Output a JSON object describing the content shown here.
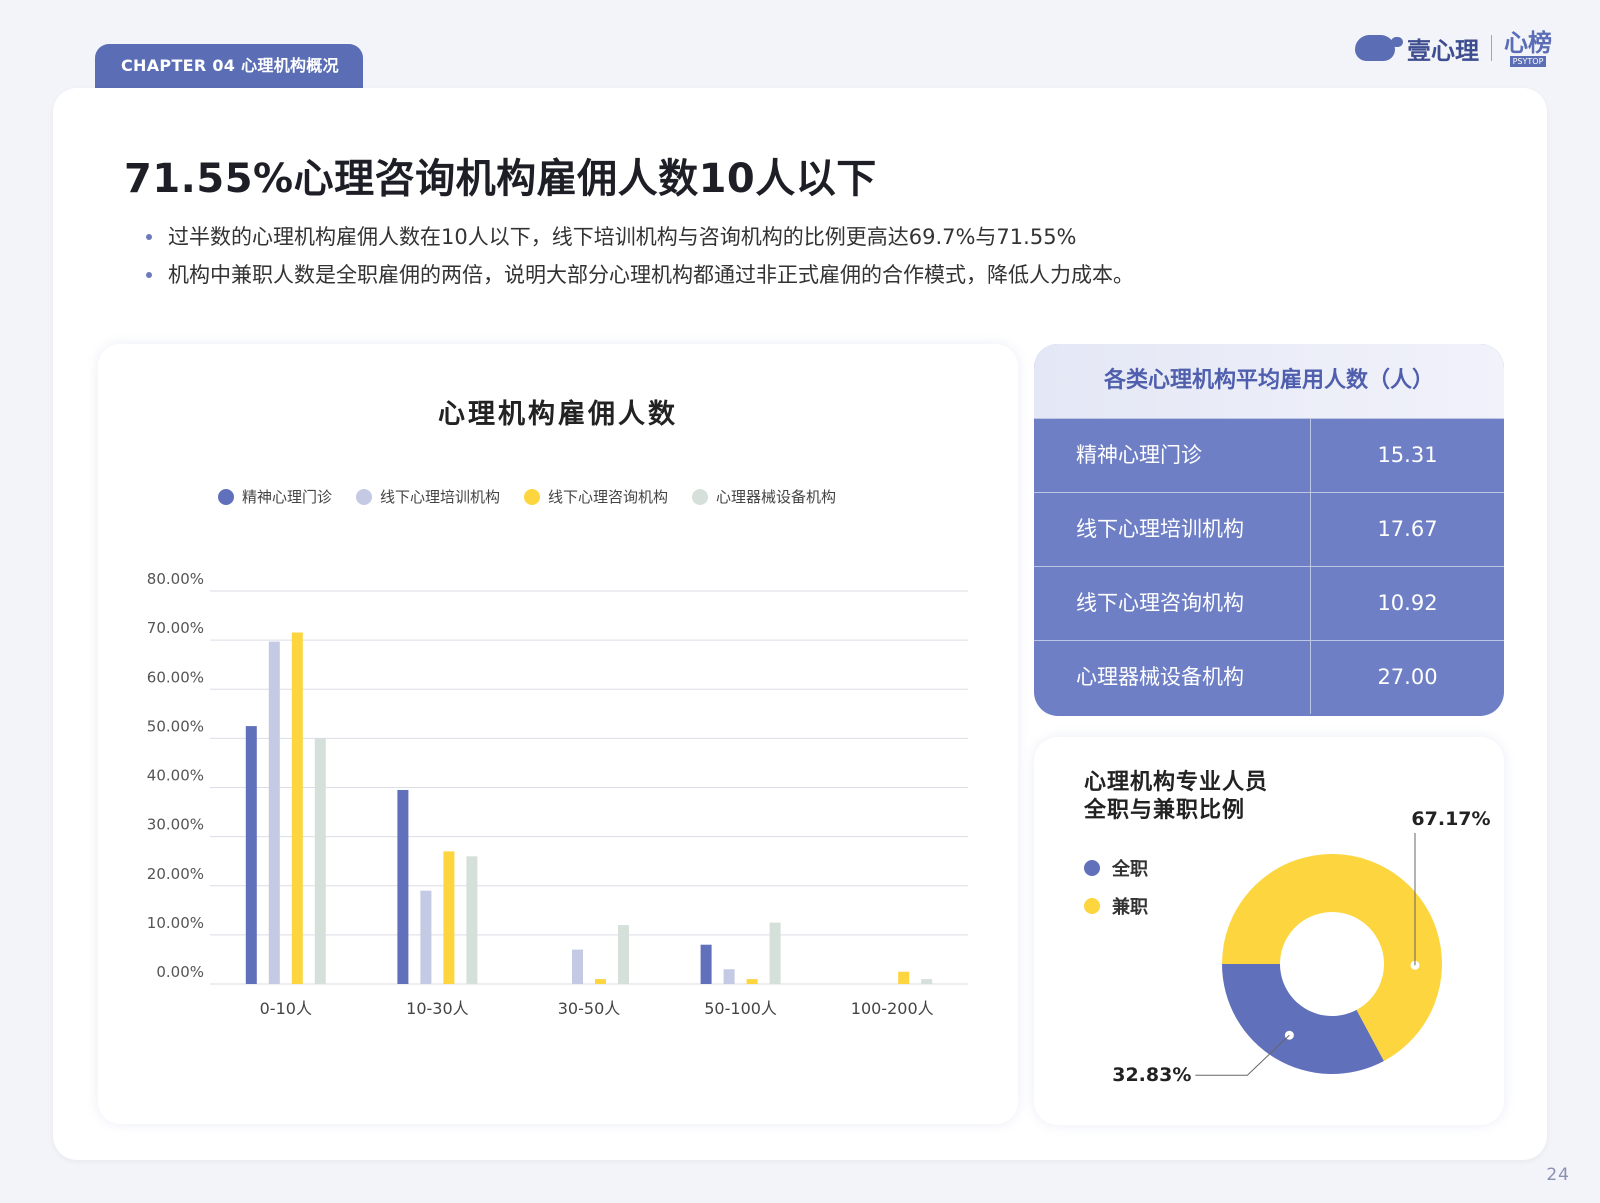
{
  "header": {
    "chapter": "CHAPTER 04  心理机构概况",
    "logo_text": "壹心理",
    "logo_box": "心榜",
    "logo_box_sub": "PSYTOP"
  },
  "headline": "71.55%心理咨询机构雇佣人数10人以下",
  "bullets": [
    "过半数的心理机构雇佣人数在10人以下，线下培训机构与咨询机构的比例更高达69.7%与71.55%",
    "机构中兼职人数是全职雇佣的两倍，说明大部分心理机构都通过非正式雇佣的合作模式，降低人力成本。"
  ],
  "colors": {
    "primary": "#5a6db5",
    "bar_series": [
      "#6070bb",
      "#c4c9e4",
      "#fcd53f",
      "#d6e0db"
    ],
    "pie_fulltime": "#6070bb",
    "pie_parttime": "#fcd53f"
  },
  "table": {
    "title": "各类心理机构平均雇用人数（人）",
    "rows": [
      {
        "label": "精神心理门诊",
        "value": "15.31"
      },
      {
        "label": "线下心理培训机构",
        "value": "17.67"
      },
      {
        "label": "线下心理咨询机构",
        "value": "10.92"
      },
      {
        "label": "心理器械设备机构",
        "value": "27.00"
      }
    ]
  },
  "pie": {
    "title_line1": "心理机构专业人员",
    "title_line2": "全职与兼职比例",
    "legend": [
      "全职",
      "兼职"
    ]
  },
  "page_number": "24",
  "chart_data": [
    {
      "type": "bar",
      "title": "心理机构雇佣人数",
      "categories": [
        "0-10人",
        "10-30人",
        "30-50人",
        "50-100人",
        "100-200人"
      ],
      "series": [
        {
          "name": "精神心理门诊",
          "values": [
            52.5,
            39.5,
            0,
            8,
            0
          ]
        },
        {
          "name": "线下心理培训机构",
          "values": [
            69.7,
            19,
            7,
            3,
            0
          ]
        },
        {
          "name": "线下心理咨询机构",
          "values": [
            71.55,
            27,
            1,
            1,
            2.5
          ]
        },
        {
          "name": "心理器械设备机构",
          "values": [
            50,
            26,
            12,
            12.5,
            1
          ]
        }
      ],
      "ylim": [
        0,
        80
      ],
      "yticks": [
        "80.00%",
        "70.00%",
        "60.00%",
        "50.00%",
        "40.00%",
        "30.00%",
        "20.00%",
        "10.00%",
        "0.00%"
      ],
      "grid": true,
      "legend_position": "top"
    },
    {
      "type": "pie",
      "title": "心理机构专业人员全职与兼职比例",
      "slices": [
        {
          "name": "全职",
          "value": 32.83,
          "label": "32.83%"
        },
        {
          "name": "兼职",
          "value": 67.17,
          "label": "67.17%"
        }
      ],
      "donut": true
    }
  ]
}
